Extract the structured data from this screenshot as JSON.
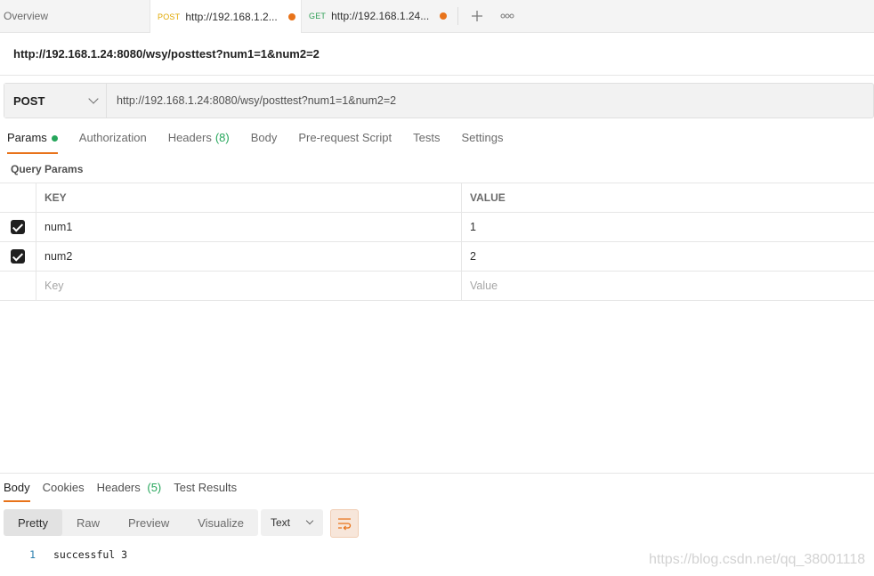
{
  "tabs": {
    "overview_label": "Overview",
    "items": [
      {
        "method": "POST",
        "url": "http://192.168.1.2...",
        "active": true
      },
      {
        "method": "GET",
        "url": "http://192.168.1.24...",
        "active": false
      }
    ],
    "add_icon": "plus-icon",
    "more_icon": "more-icon"
  },
  "request": {
    "title": "http://192.168.1.24:8080/wsy/posttest?num1=1&num2=2",
    "method": "POST",
    "url": "http://192.168.1.24:8080/wsy/posttest?num1=1&num2=2"
  },
  "request_tabs": {
    "params": "Params",
    "authorization": "Authorization",
    "headers": "Headers",
    "headers_count": "(8)",
    "body": "Body",
    "prerequest": "Pre-request Script",
    "tests": "Tests",
    "settings": "Settings"
  },
  "query_params": {
    "label": "Query Params",
    "key_header": "KEY",
    "value_header": "VALUE",
    "rows": [
      {
        "key": "num1",
        "value": "1",
        "checked": true
      },
      {
        "key": "num2",
        "value": "2",
        "checked": true
      }
    ],
    "key_placeholder": "Key",
    "value_placeholder": "Value"
  },
  "response": {
    "tabs": {
      "body": "Body",
      "cookies": "Cookies",
      "headers": "Headers",
      "headers_count": "(5)",
      "test_results": "Test Results"
    },
    "view_modes": [
      "Pretty",
      "Raw",
      "Preview",
      "Visualize"
    ],
    "format": "Text",
    "line_number": "1",
    "body_text": "successful 3"
  },
  "watermark": "https://blog.csdn.net/qq_38001118",
  "colors": {
    "accent": "#e8731a",
    "post_method": "#e0a800",
    "get_method": "#2e9e55",
    "green": "#26a65b"
  }
}
